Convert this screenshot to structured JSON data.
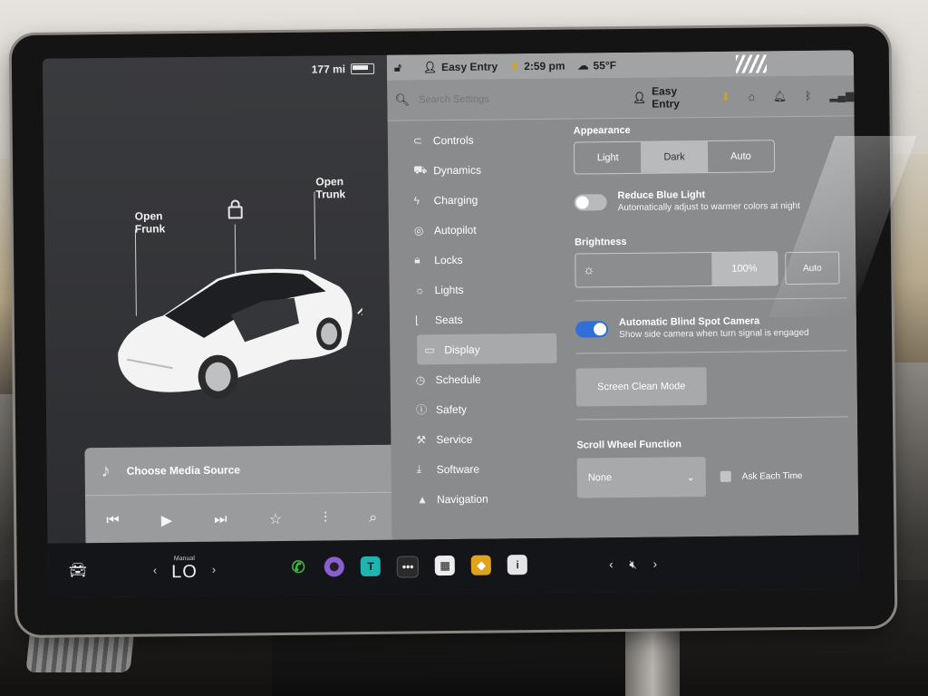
{
  "status": {
    "range": "177 mi",
    "profile": "Easy Entry",
    "time": "2:59 pm",
    "temperature": "55°F"
  },
  "car_panel": {
    "frunk_label": "Open\nFrunk",
    "trunk_label": "Open\nTrunk"
  },
  "media": {
    "source_label": "Choose Media Source",
    "controls": [
      "prev-icon",
      "play-icon",
      "next-icon",
      "star-icon",
      "equalizer-icon",
      "search-icon"
    ]
  },
  "settings": {
    "search_placeholder": "Search Settings",
    "profile": "Easy Entry",
    "menu": [
      {
        "label": "Controls",
        "icon": "toggle-icon"
      },
      {
        "label": "Dynamics",
        "icon": "car-icon"
      },
      {
        "label": "Charging",
        "icon": "bolt-icon"
      },
      {
        "label": "Autopilot",
        "icon": "steering-icon"
      },
      {
        "label": "Locks",
        "icon": "lock-icon"
      },
      {
        "label": "Lights",
        "icon": "light-icon"
      },
      {
        "label": "Seats",
        "icon": "seat-icon"
      },
      {
        "label": "Display",
        "icon": "display-icon",
        "active": true
      },
      {
        "label": "Schedule",
        "icon": "clock-icon"
      },
      {
        "label": "Safety",
        "icon": "info-icon"
      },
      {
        "label": "Service",
        "icon": "wrench-icon"
      },
      {
        "label": "Software",
        "icon": "download-icon"
      },
      {
        "label": "Navigation",
        "icon": "nav-icon"
      }
    ],
    "appearance": {
      "title": "Appearance",
      "options": [
        "Light",
        "Dark",
        "Auto"
      ],
      "selected": "Dark"
    },
    "blue_light": {
      "title": "Reduce Blue Light",
      "subtitle": "Automatically adjust to warmer colors at night",
      "enabled": false
    },
    "brightness": {
      "title": "Brightness",
      "value": "100%",
      "level": 1.0,
      "auto_label": "Auto"
    },
    "blind_spot": {
      "title": "Automatic Blind Spot Camera",
      "subtitle": "Show side camera when turn signal is engaged",
      "enabled": true
    },
    "clean_mode_label": "Screen Clean Mode",
    "scroll_wheel": {
      "title": "Scroll Wheel Function",
      "value": "None",
      "ask_label": "Ask Each Time"
    }
  },
  "dock": {
    "climate_mode": "Manual",
    "temp": "LO",
    "apps": [
      {
        "name": "phone-icon",
        "color": "#3fb83a"
      },
      {
        "name": "camera-icon",
        "color": "#8b5fd0"
      },
      {
        "name": "toybox-icon",
        "color": "#1fb4b0"
      },
      {
        "name": "more-icon",
        "color": "#2a2a2a"
      },
      {
        "name": "calendar-icon",
        "color": "#ededed"
      },
      {
        "name": "dashcam-icon",
        "color": "#e0a31c"
      },
      {
        "name": "manual-icon",
        "color": "#e5e5e5"
      }
    ]
  },
  "colors": {
    "toggle_on": "#2f6fd9",
    "download_icon": "#d4a21e"
  }
}
